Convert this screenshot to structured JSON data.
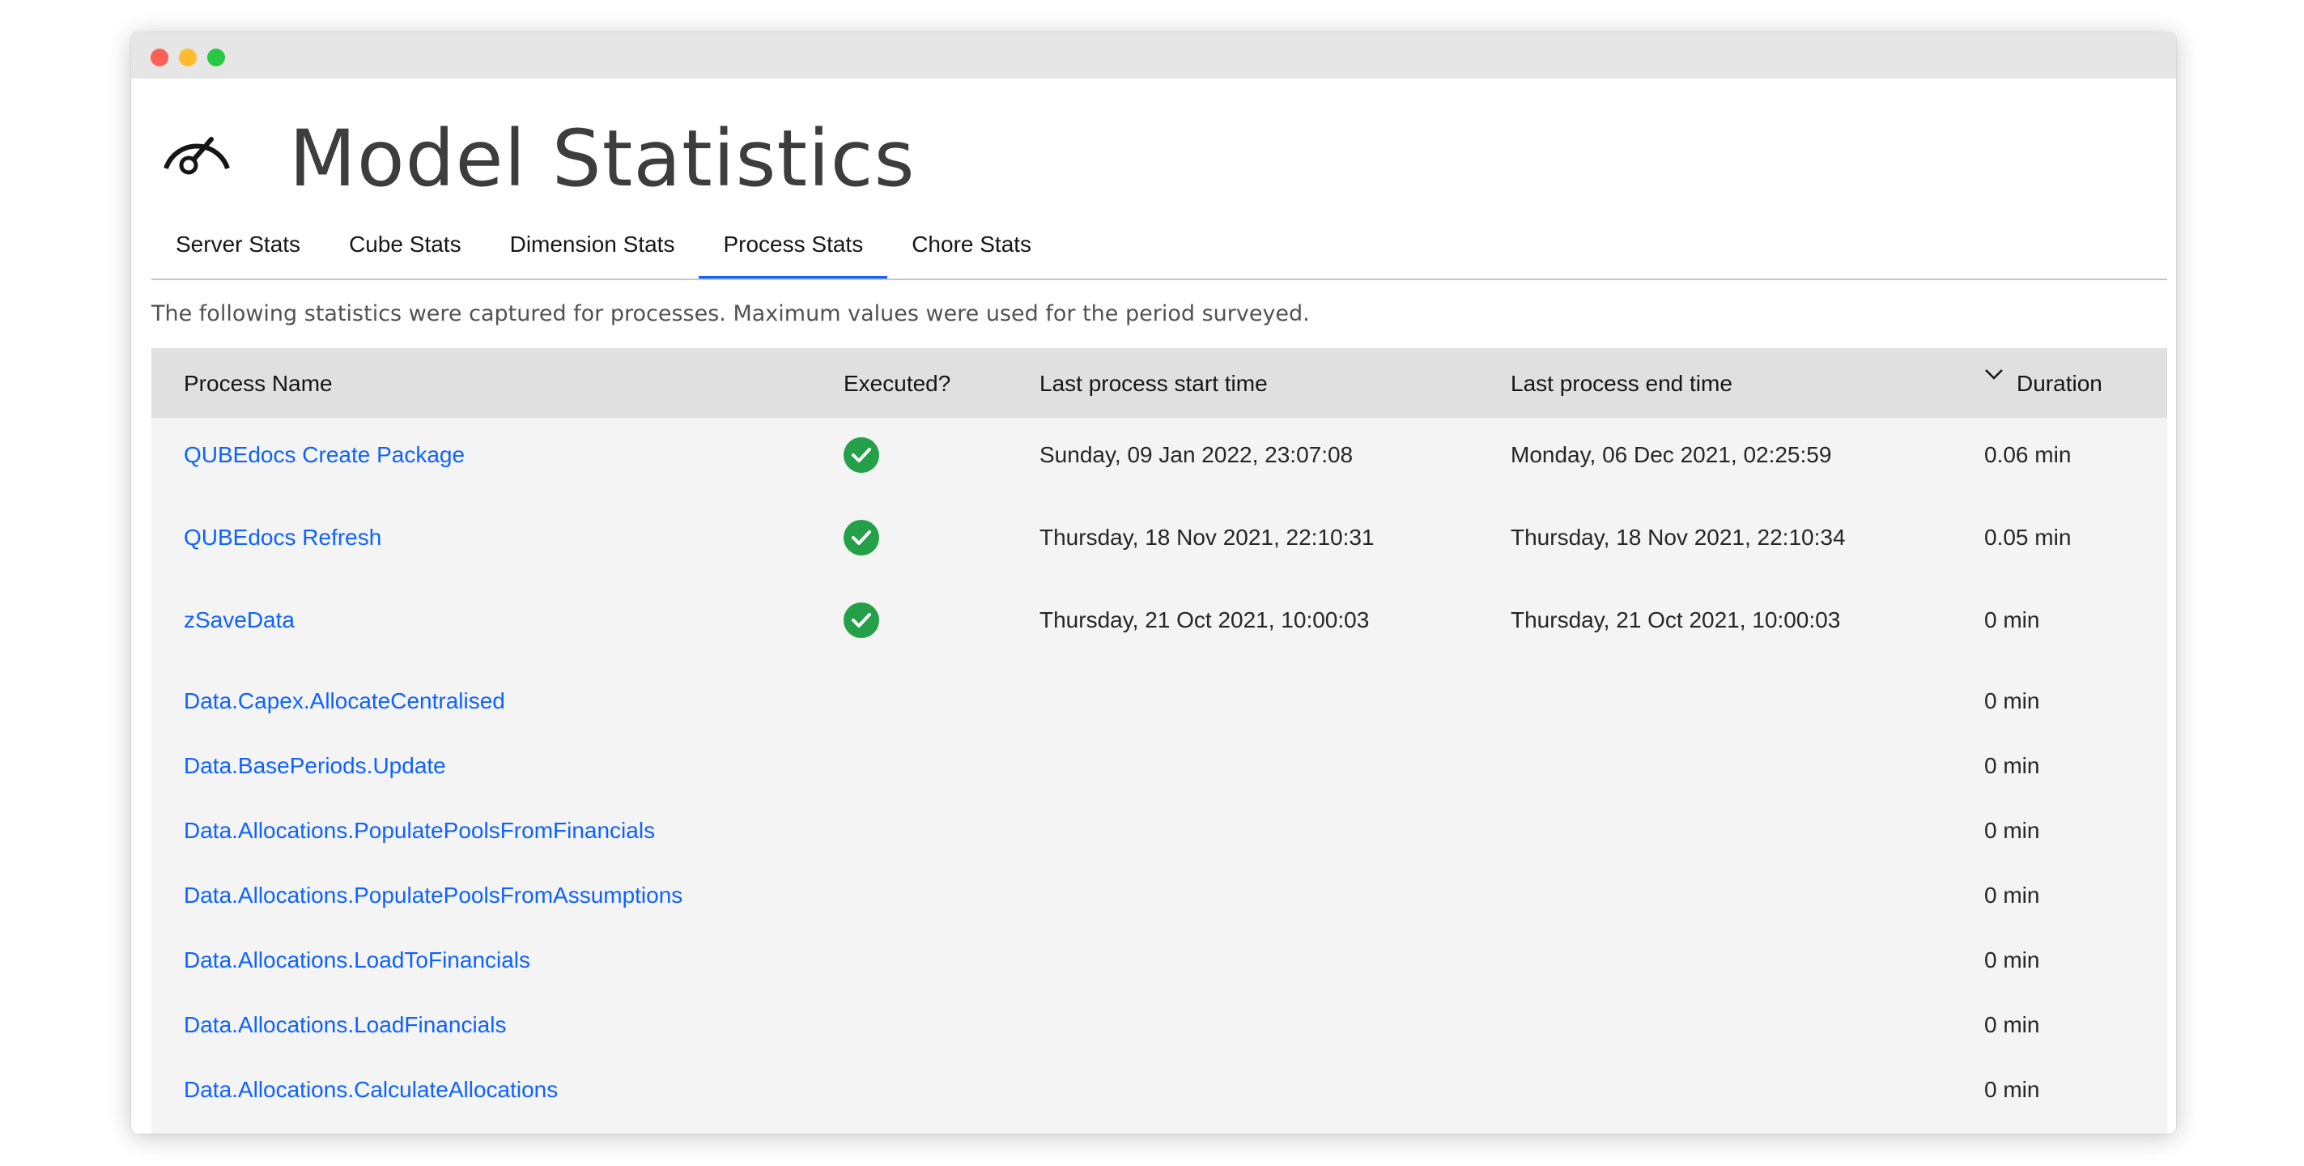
{
  "window": {
    "traffic_lights": [
      "#fe5f57",
      "#febc2e",
      "#28c840"
    ]
  },
  "header": {
    "icon": "gauge-icon",
    "title": "Model Statistics"
  },
  "tabs": [
    {
      "label": "Server Stats",
      "active": false
    },
    {
      "label": "Cube Stats",
      "active": false
    },
    {
      "label": "Dimension Stats",
      "active": false
    },
    {
      "label": "Process Stats",
      "active": true
    },
    {
      "label": "Chore Stats",
      "active": false
    }
  ],
  "description": "The following statistics were captured for processes. Maximum values were used for the period surveyed.",
  "table": {
    "columns": {
      "name": "Process Name",
      "executed": "Executed?",
      "start": "Last process start time",
      "end": "Last process end time",
      "duration": "Duration"
    },
    "sort": {
      "column": "duration",
      "direction": "descending",
      "icon": "chevron-down-icon"
    },
    "rows": [
      {
        "name": "QUBEdocs Create Package",
        "executed": true,
        "start": "Sunday, 09 Jan 2022, 23:07:08",
        "end": "Monday, 06 Dec 2021, 02:25:59",
        "duration": "0.06 min"
      },
      {
        "name": "QUBEdocs Refresh",
        "executed": true,
        "start": "Thursday, 18 Nov 2021, 22:10:31",
        "end": "Thursday, 18 Nov 2021, 22:10:34",
        "duration": "0.05 min"
      },
      {
        "name": "zSaveData",
        "executed": true,
        "start": "Thursday, 21 Oct 2021, 10:00:03",
        "end": "Thursday, 21 Oct 2021, 10:00:03",
        "duration": "0 min"
      },
      {
        "name": "Data.Capex.AllocateCentralised",
        "executed": false,
        "start": "",
        "end": "",
        "duration": "0 min"
      },
      {
        "name": "Data.BasePeriods.Update",
        "executed": false,
        "start": "",
        "end": "",
        "duration": "0 min"
      },
      {
        "name": "Data.Allocations.PopulatePoolsFromFinancials",
        "executed": false,
        "start": "",
        "end": "",
        "duration": "0 min"
      },
      {
        "name": "Data.Allocations.PopulatePoolsFromAssumptions",
        "executed": false,
        "start": "",
        "end": "",
        "duration": "0 min"
      },
      {
        "name": "Data.Allocations.LoadToFinancials",
        "executed": false,
        "start": "",
        "end": "",
        "duration": "0 min"
      },
      {
        "name": "Data.Allocations.LoadFinancials",
        "executed": false,
        "start": "",
        "end": "",
        "duration": "0 min"
      },
      {
        "name": "Data.Allocations.CalculateAllocations",
        "executed": false,
        "start": "",
        "end": "",
        "duration": "0 min"
      }
    ],
    "executed_icon": "check-circle-icon",
    "executed_color": "#24a148",
    "link_color": "#0f62fe"
  }
}
